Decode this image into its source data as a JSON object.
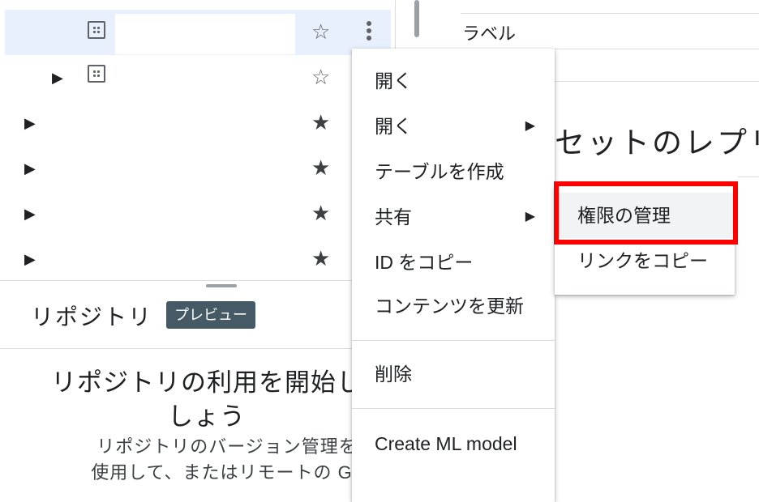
{
  "explorer": {
    "rows": [
      {
        "expand_arrow": "",
        "icon": "dataset-icon",
        "star": "☆",
        "selected": true
      },
      {
        "expand_arrow": "▶",
        "icon": "dataset-icon",
        "star": "☆"
      },
      {
        "expand_arrow": "▶",
        "star": "★"
      },
      {
        "expand_arrow": "▶",
        "star": "★"
      },
      {
        "expand_arrow": "▶",
        "star": "★"
      },
      {
        "expand_arrow": "▶",
        "star": "★"
      }
    ]
  },
  "repositories": {
    "title": "リポジトリ",
    "badge": "プレビュー",
    "heading_line1": "リポジトリの利用を開始し",
    "heading_line2": "しょう",
    "desc_line1": "リポジトリのバージョン管理を",
    "desc_line2": "使用して、またはリモートの Git"
  },
  "details": {
    "label": "ラベル",
    "section_heading": "セットのレプリ"
  },
  "context_menu": {
    "items": [
      {
        "label": "開く"
      },
      {
        "label": "開く",
        "submenu_arrow": "▶"
      },
      {
        "label": "テーブルを作成"
      },
      {
        "label": "共有",
        "submenu_arrow": "▶"
      },
      {
        "label": "ID をコピー"
      },
      {
        "label": "コンテンツを更新"
      },
      {
        "label": "削除"
      },
      {
        "label": "Create ML model"
      }
    ]
  },
  "share_submenu": {
    "items": [
      {
        "label": "権限の管理",
        "highlighted": true
      },
      {
        "label": "リンクをコピー"
      }
    ]
  },
  "colors": {
    "selection": "#e8f0fe",
    "badge_bg": "#455a64",
    "highlight_border": "#ff0000"
  }
}
